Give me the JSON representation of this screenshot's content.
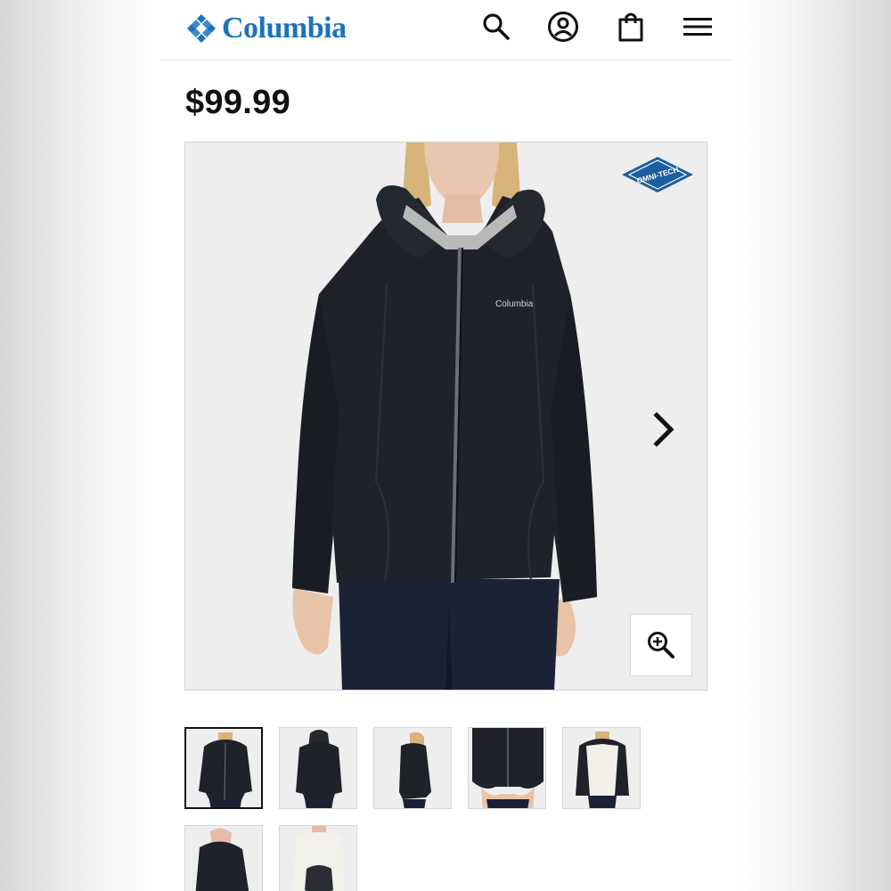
{
  "header": {
    "brand_name": "Columbia",
    "brand_color": "#1b74b8",
    "icons": [
      "search-icon",
      "account-icon",
      "shopping-bag-icon",
      "menu-icon"
    ]
  },
  "product": {
    "price": "$99.99",
    "hero_logo_text": "Columbia",
    "tech_badge": "OMNI-TECH",
    "hero_icons": [
      "chevron-right-icon",
      "zoom-in-icon"
    ]
  },
  "gallery": {
    "thumbnail_count": 7,
    "selected_index": 0
  }
}
